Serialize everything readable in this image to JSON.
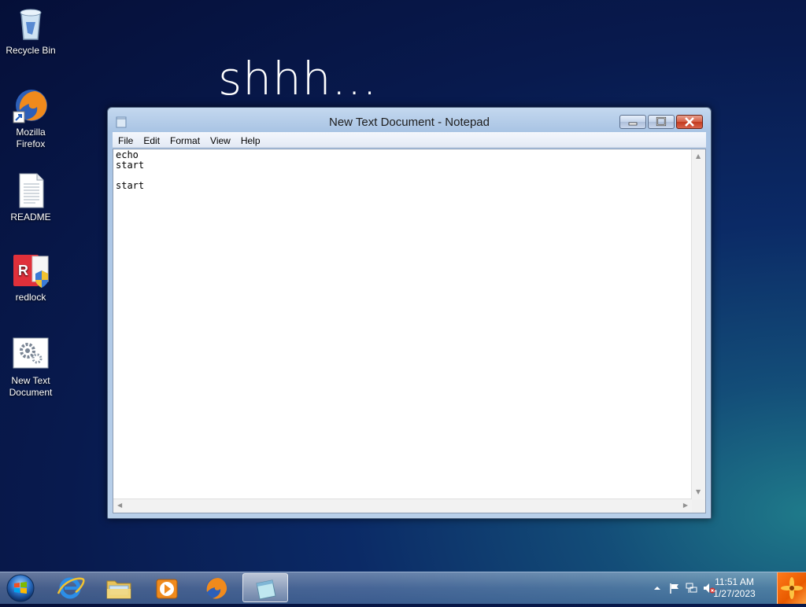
{
  "wallpaper": {
    "text": "shhh..."
  },
  "desktop_icons": [
    {
      "label": "Recycle Bin",
      "icon": "recycle-bin-icon"
    },
    {
      "label": "Mozilla Firefox",
      "icon": "firefox-icon"
    },
    {
      "label": "README",
      "icon": "text-file-icon"
    },
    {
      "label": "redlock",
      "icon": "redlock-icon"
    },
    {
      "label": "New Text Document",
      "icon": "settings-file-icon"
    }
  ],
  "window": {
    "title": "New Text Document - Notepad",
    "menu": [
      "File",
      "Edit",
      "Format",
      "View",
      "Help"
    ],
    "content": "echo\nstart\n\nstart"
  },
  "taskbar": {
    "buttons": [
      "internet-explorer-icon",
      "windows-explorer-icon",
      "media-player-icon",
      "firefox-icon",
      "notepad-icon"
    ],
    "active": "notepad-icon"
  },
  "tray": {
    "time": "11:51 AM",
    "date": "1/27/2023",
    "icons": [
      "show-hidden-icons-icon",
      "action-center-flag-icon",
      "network-icon",
      "volume-muted-icon"
    ]
  },
  "colors": {
    "titlebar": "#b8cfe9",
    "close_button": "#d45f45",
    "show_desktop": "#e85a00"
  }
}
